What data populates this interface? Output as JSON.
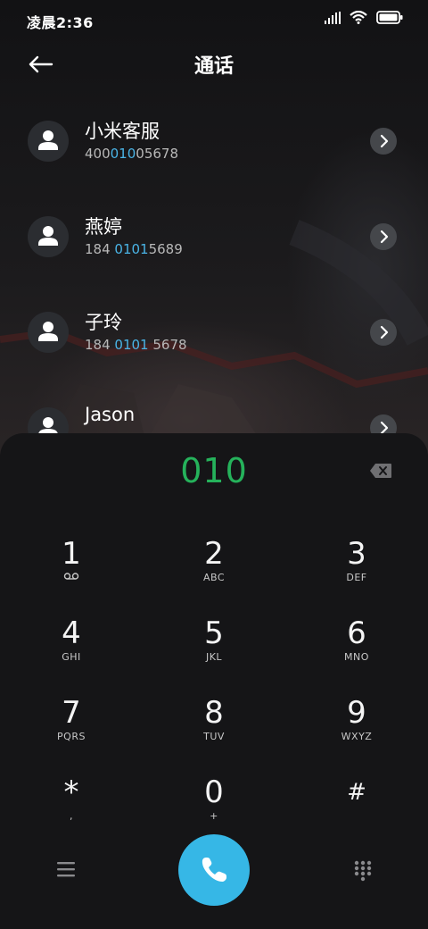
{
  "status_bar": {
    "time": "凌晨2:36"
  },
  "header": {
    "title": "通话"
  },
  "contacts": [
    {
      "name": "小米客服",
      "number_pre": "400",
      "number_match": "010",
      "number_post": "05678"
    },
    {
      "name": "燕婷",
      "number_pre": "184 ",
      "number_match": "0101",
      "number_post": "5689"
    },
    {
      "name": "子玲",
      "number_pre": "184 ",
      "number_match": "0101",
      "number_post": " 5678"
    },
    {
      "name": "Jason",
      "number_pre": "",
      "number_match": "",
      "number_post": ""
    }
  ],
  "dialer": {
    "input": "010",
    "keys": [
      {
        "digit": "1",
        "sub": ""
      },
      {
        "digit": "2",
        "sub": "ABC"
      },
      {
        "digit": "3",
        "sub": "DEF"
      },
      {
        "digit": "4",
        "sub": "GHI"
      },
      {
        "digit": "5",
        "sub": "JKL"
      },
      {
        "digit": "6",
        "sub": "MNO"
      },
      {
        "digit": "7",
        "sub": "PQRS"
      },
      {
        "digit": "8",
        "sub": "TUV"
      },
      {
        "digit": "9",
        "sub": "WXYZ"
      },
      {
        "digit": "*",
        "sub": ","
      },
      {
        "digit": "0",
        "sub": "+"
      },
      {
        "digit": "#",
        "sub": ""
      }
    ]
  },
  "colors": {
    "accent_call": "#36b7e6",
    "dial_input": "#25b25b",
    "number_highlight": "#4ab4e6"
  },
  "icons": {
    "back": "arrow-left-icon",
    "chevron": "chevron-right-icon",
    "delete": "backspace-icon",
    "voicemail": "voicemail-icon",
    "menu": "menu-icon",
    "call": "phone-icon",
    "keypad": "dialpad-icon"
  }
}
